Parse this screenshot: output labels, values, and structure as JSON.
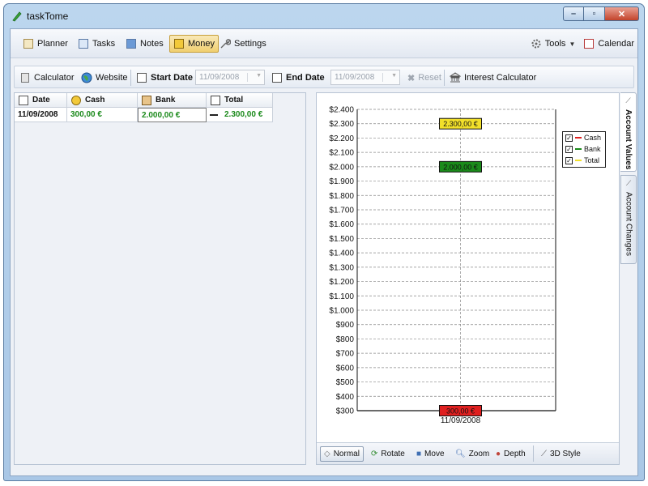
{
  "window": {
    "title": "taskTome"
  },
  "nav": {
    "planner": "Planner",
    "tasks": "Tasks",
    "notes": "Notes",
    "money": "Money",
    "settings": "Settings",
    "tools": "Tools",
    "calendar": "Calendar"
  },
  "toolbar": {
    "calculator": "Calculator",
    "website": "Website",
    "start_date_label": "Start Date",
    "start_date_value": "11/09/2008",
    "end_date_label": "End Date",
    "end_date_value": "11/09/2008",
    "reset": "Reset",
    "interest_calculator": "Interest Calculator"
  },
  "table": {
    "headers": {
      "date": "Date",
      "cash": "Cash",
      "bank": "Bank",
      "total": "Total"
    },
    "rows": [
      {
        "date": "11/09/2008",
        "cash": "300,00 €",
        "bank": "2.000,00 €",
        "total": "2.300,00 €"
      }
    ]
  },
  "side_tabs": {
    "values": "Account Values",
    "changes": "Account Changes"
  },
  "chart_controls": {
    "normal": "Normal",
    "rotate": "Rotate",
    "move": "Move",
    "zoom": "Zoom",
    "depth": "Depth",
    "style3d": "3D Style"
  },
  "colors": {
    "cash": "#e02020",
    "bank": "#1a8a1a",
    "total": "#f2e02a",
    "accent_active": "#f0cf6f"
  },
  "chart_data": {
    "type": "scatter",
    "x": [
      "11/09/2008"
    ],
    "series": [
      {
        "name": "Cash",
        "values": [
          300
        ],
        "label": "300,00 €",
        "color": "#e02020"
      },
      {
        "name": "Bank",
        "values": [
          2000
        ],
        "label": "2.000,00 €",
        "color": "#1a8a1a"
      },
      {
        "name": "Total",
        "values": [
          2300
        ],
        "label": "2.300,00 €",
        "color": "#f2e02a"
      }
    ],
    "ylim": [
      300,
      2400
    ],
    "yticks": [
      "$300",
      "$400",
      "$500",
      "$600",
      "$700",
      "$800",
      "$900",
      "$1.000",
      "$1.100",
      "$1.200",
      "$1.300",
      "$1.400",
      "$1.500",
      "$1.600",
      "$1.700",
      "$1.800",
      "$1.900",
      "$2.000",
      "$2.100",
      "$2.200",
      "$2.300",
      "$2.400"
    ],
    "grid": true,
    "legend_position": "right",
    "legend_checked": [
      true,
      true,
      true
    ]
  }
}
